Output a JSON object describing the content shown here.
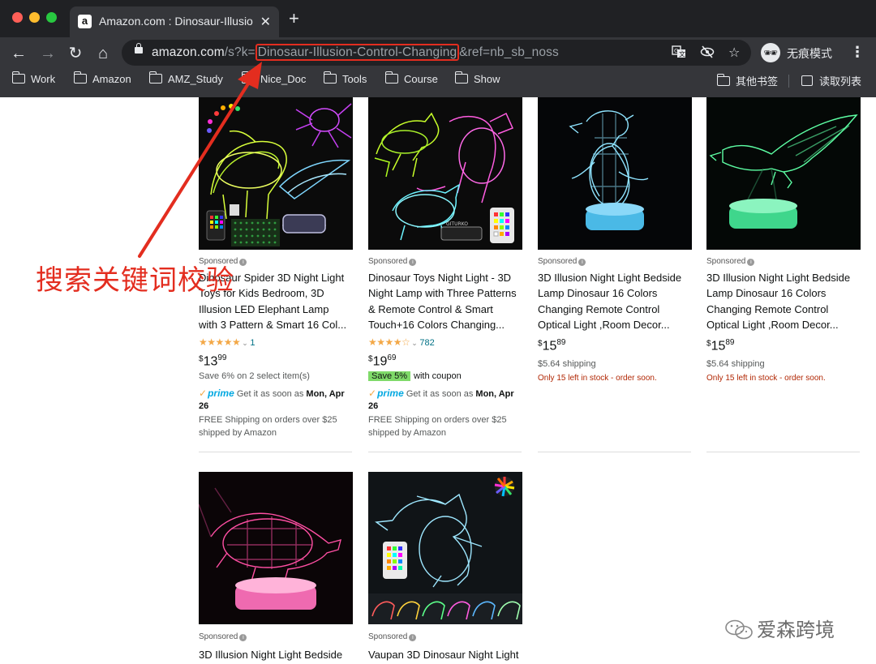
{
  "browser": {
    "tab_title": "Amazon.com : Dinosaur-Illusion-Control-Changing",
    "tab_favicon": "a",
    "url_host": "amazon.com",
    "url_prefix": "/s?k=",
    "url_keyword": "Dinosaur-Illusion-Control-Changing",
    "url_suffix": "&ref=nb_sb_noss",
    "incognito_label": "无痕模式",
    "bookmarks": [
      "Work",
      "Amazon",
      "AMZ_Study",
      "Nice_Doc",
      "Tools",
      "Course",
      "Show"
    ],
    "other_bookmarks": "其他书签",
    "reading_list": "读取列表"
  },
  "annotation": {
    "text": "搜索关键词校验",
    "color": "#e32d1f"
  },
  "watermark": "爱森跨境",
  "sponsored_label": "Sponsored",
  "products": [
    {
      "title_l1": "Dinosaur Spider 3D Night Light",
      "title_l2": "Toys for Kids Bedroom, 3D",
      "title_l3": "Illusion LED Elephant Lamp",
      "title_l4": "with 3 Pattern & Smart 16 Col...",
      "stars": "★★★★★",
      "rating_count": "1",
      "price_whole": "13",
      "price_fraction": "99",
      "line1": "Save 6% on 2 select item(s)",
      "prime": "prime",
      "delivery_text": "Get it as soon as",
      "delivery_date": "Mon, Apr",
      "delivery_date2": "26",
      "free_ship": "FREE Shipping on orders over $25",
      "shipped_by": "shipped by Amazon"
    },
    {
      "title_l1": "Dinosaur Toys Night Light - 3D",
      "title_l2": "Night Lamp with Three Patterns",
      "title_l3": "& Remote Control & Smart",
      "title_l4": "Touch+16 Colors Changing...",
      "stars": "★★★★☆",
      "rating_count": "782",
      "price_whole": "19",
      "price_fraction": "69",
      "coupon_badge": "Save 5%",
      "coupon_text": "with coupon",
      "prime": "prime",
      "delivery_text": "Get it as soon as",
      "delivery_date": "Mon, Apr",
      "delivery_date2": "26",
      "free_ship": "FREE Shipping on orders over $25",
      "shipped_by": "shipped by Amazon",
      "image_brand": "GITURKO"
    },
    {
      "title_l1": "3D Illusion Night Light Bedside",
      "title_l2": "Lamp Dinosaur 16 Colors",
      "title_l3": "Changing Remote Control",
      "title_l4": "Optical Light ,Room Decor...",
      "price_whole": "15",
      "price_fraction": "89",
      "shipping": "$5.64 shipping",
      "stock": "Only 15 left in stock - order soon."
    },
    {
      "title_l1": "3D Illusion Night Light Bedside",
      "title_l2": "Lamp Dinosaur 16 Colors",
      "title_l3": "Changing Remote Control",
      "title_l4": "Optical Light ,Room Decor...",
      "price_whole": "15",
      "price_fraction": "89",
      "shipping": "$5.64 shipping",
      "stock": "Only 15 left in stock - order soon."
    },
    {
      "title_l1": "3D Illusion Night Light Bedside"
    },
    {
      "title_l1": "Vaupan 3D Dinosaur Night Light"
    }
  ]
}
